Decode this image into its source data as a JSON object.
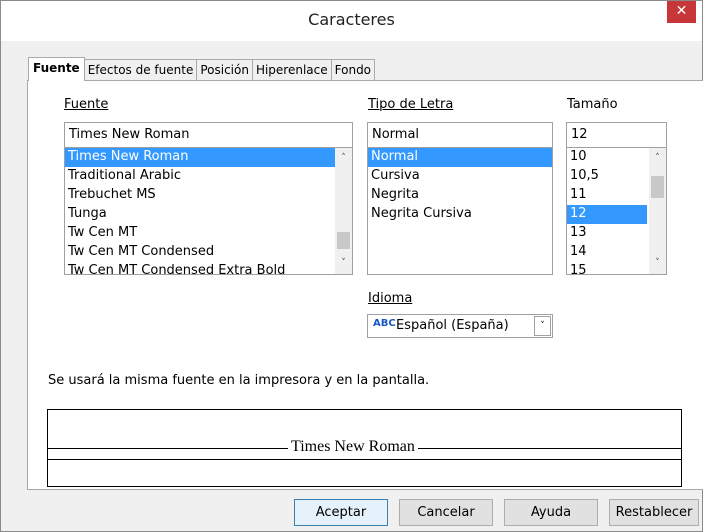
{
  "window": {
    "title": "Caracteres",
    "close_glyph": "✕"
  },
  "tabs": [
    {
      "label": "Fuente",
      "active": true
    },
    {
      "label": "Efectos de fuente",
      "active": false
    },
    {
      "label": "Posición",
      "active": false
    },
    {
      "label": "Hiperenlace",
      "active": false
    },
    {
      "label": "Fondo",
      "active": false
    }
  ],
  "font": {
    "label": "Fuente",
    "value": "Times New Roman",
    "items": [
      "Times New Roman",
      "Traditional Arabic",
      "Trebuchet MS",
      "Tunga",
      "Tw Cen MT",
      "Tw Cen MT Condensed",
      "Tw Cen MT Condensed Extra Bold"
    ],
    "selected": "Times New Roman"
  },
  "style": {
    "label": "Tipo de Letra",
    "value": "Normal",
    "items": [
      "Normal",
      "Cursiva",
      "Negrita",
      "Negrita Cursiva"
    ],
    "selected": "Normal"
  },
  "size": {
    "label": "Tamaño",
    "value": "12",
    "items": [
      "10",
      "10,5",
      "11",
      "12",
      "13",
      "14",
      "15"
    ],
    "selected": "12"
  },
  "language": {
    "label": "Idioma",
    "value": "Español (España)",
    "icon_name": "spellcheck-icon",
    "icon_glyph": "ABC"
  },
  "note": "Se usará la misma fuente en la impresora y en la pantalla.",
  "preview": {
    "text": "Times New Roman"
  },
  "buttons": {
    "ok": "Aceptar",
    "cancel": "Cancelar",
    "help": "Ayuda",
    "reset": "Restablecer"
  }
}
